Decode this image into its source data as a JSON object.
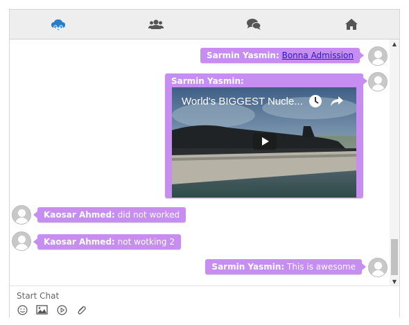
{
  "tabs": [
    {
      "name": "cloud-share",
      "icon": "cloud-share-icon"
    },
    {
      "name": "contacts",
      "icon": "users-icon"
    },
    {
      "name": "chats",
      "icon": "comments-icon"
    },
    {
      "name": "home",
      "icon": "home-icon"
    }
  ],
  "messages": [
    {
      "sender": "Sarmin Yasmin:",
      "text": "Bonna Admission",
      "is_link": true,
      "side": "right"
    },
    {
      "sender": "Sarmin Yasmin:",
      "video_title": "World's BIGGEST Nucle...",
      "side": "right"
    },
    {
      "sender": "Kaosar Ahmed:",
      "text": "did not worked",
      "side": "left"
    },
    {
      "sender": "Kaosar Ahmed:",
      "text": "not wotking 2",
      "side": "left"
    },
    {
      "sender": "Sarmin Yasmin:",
      "text": "This is awesome",
      "side": "right"
    }
  ],
  "composer": {
    "placeholder": "Start Chat",
    "tools": [
      "emoji-icon",
      "image-icon",
      "video-icon",
      "attachment-icon"
    ]
  },
  "colors": {
    "bubble": "#c58ef0",
    "link": "#2a16c6",
    "tab_active": "#2a7ec8",
    "tab_icon": "#555555"
  }
}
